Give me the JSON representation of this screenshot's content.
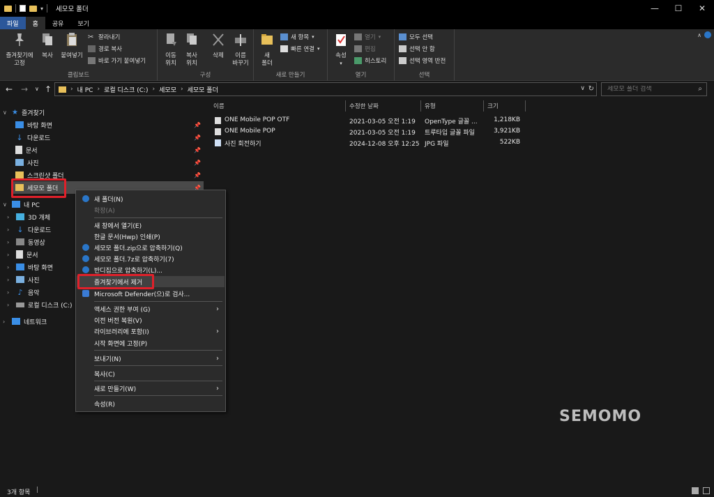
{
  "window": {
    "title": "세모모 폴더",
    "controls": [
      "—",
      "☐",
      "✕"
    ]
  },
  "ribbon_tabs": [
    {
      "label": "파일"
    },
    {
      "label": "홈"
    },
    {
      "label": "공유"
    },
    {
      "label": "보기"
    }
  ],
  "ribbon": {
    "clipboard": {
      "pin_line1": "즐겨찾기에",
      "pin_line2": "고정",
      "copy": "복사",
      "paste": "붙여넣기",
      "cut": "잘라내기",
      "copy_path": "경로 복사",
      "paste_shortcut": "바로 가기 붙여넣기",
      "label": "클립보드"
    },
    "organize": {
      "move_line1": "이동",
      "move_line2": "위치",
      "copyto_line1": "복사",
      "copyto_line2": "위치",
      "delete": "삭제",
      "rename_line1": "이름",
      "rename_line2": "바꾸기",
      "label": "구성"
    },
    "new": {
      "folder_line1": "새",
      "folder_line2": "폴더",
      "new_item": "새 항목",
      "easy_access": "빠른 연결",
      "label": "새로 만들기"
    },
    "open": {
      "properties": "속성",
      "open": "열기",
      "edit": "편집",
      "history": "히스토리",
      "label": "열기"
    },
    "select": {
      "select_all": "모두 선택",
      "select_none": "선택 안 함",
      "invert": "선택 영역 반전",
      "label": "선택"
    }
  },
  "address": {
    "crumbs": [
      "내 PC",
      "로컬 디스크 (C:)",
      "세모모",
      "세모모 폴더"
    ],
    "search_placeholder": "세모모 폴더 검색"
  },
  "navpane": {
    "quick_access": "즐겨찾기",
    "quick_items": [
      "바탕 화면",
      "다운로드",
      "문서",
      "사진",
      "스크린샷 폴더",
      "세모모 폴더"
    ],
    "this_pc": "내 PC",
    "pc_items": [
      "3D 개체",
      "다운로드",
      "동영상",
      "문서",
      "바탕 화면",
      "사진",
      "음악",
      "로컬 디스크 (C:)"
    ],
    "network": "네트워크"
  },
  "columns": [
    "이름",
    "수정한 날짜",
    "유형",
    "크기"
  ],
  "files": [
    {
      "name": "ONE Mobile POP OTF",
      "date": "2021-03-05 오전 1:19",
      "type": "OpenType 글꼴 ...",
      "size": "1,218KB"
    },
    {
      "name": "ONE Mobile POP",
      "date": "2021-03-05 오전 1:19",
      "type": "트루타입 글꼴 파일",
      "size": "3,921KB"
    },
    {
      "name": "사진 회전하기",
      "date": "2024-12-08 오후 12:25",
      "type": "JPG 파일",
      "size": "522KB"
    }
  ],
  "context_menu": [
    {
      "label": "새 폴더(N)"
    },
    {
      "label": "확장(A)"
    },
    {
      "label": "새 창에서 열기(E)"
    },
    {
      "label": "한글 문서(Hwp) 인쇄(P)"
    },
    {
      "label": "세모모 폴더.zip으로 압축하기(Q)"
    },
    {
      "label": "세모모 폴더.7z로 압축하기(7)"
    },
    {
      "label": "반디집으로 압축하기(L)..."
    },
    {
      "label": "즐겨찾기에서 제거"
    },
    {
      "label": "Microsoft Defender(으)로 검사..."
    },
    {
      "label": "액세스 권한 부여 (G)"
    },
    {
      "label": "이전 버전 복원(V)"
    },
    {
      "label": "라이브러리에 포함(I)"
    },
    {
      "label": "시작 화면에 고정(P)"
    },
    {
      "label": "보내기(N)"
    },
    {
      "label": "복사(C)"
    },
    {
      "label": "새로 만들기(W)"
    },
    {
      "label": "속성(R)"
    }
  ],
  "status": {
    "count": "3개 항목"
  },
  "watermark": "SEMOMO",
  "colors": {
    "accent": "#2b579a",
    "highlight_box": "#e0202a",
    "folder": "#e8c05a"
  }
}
